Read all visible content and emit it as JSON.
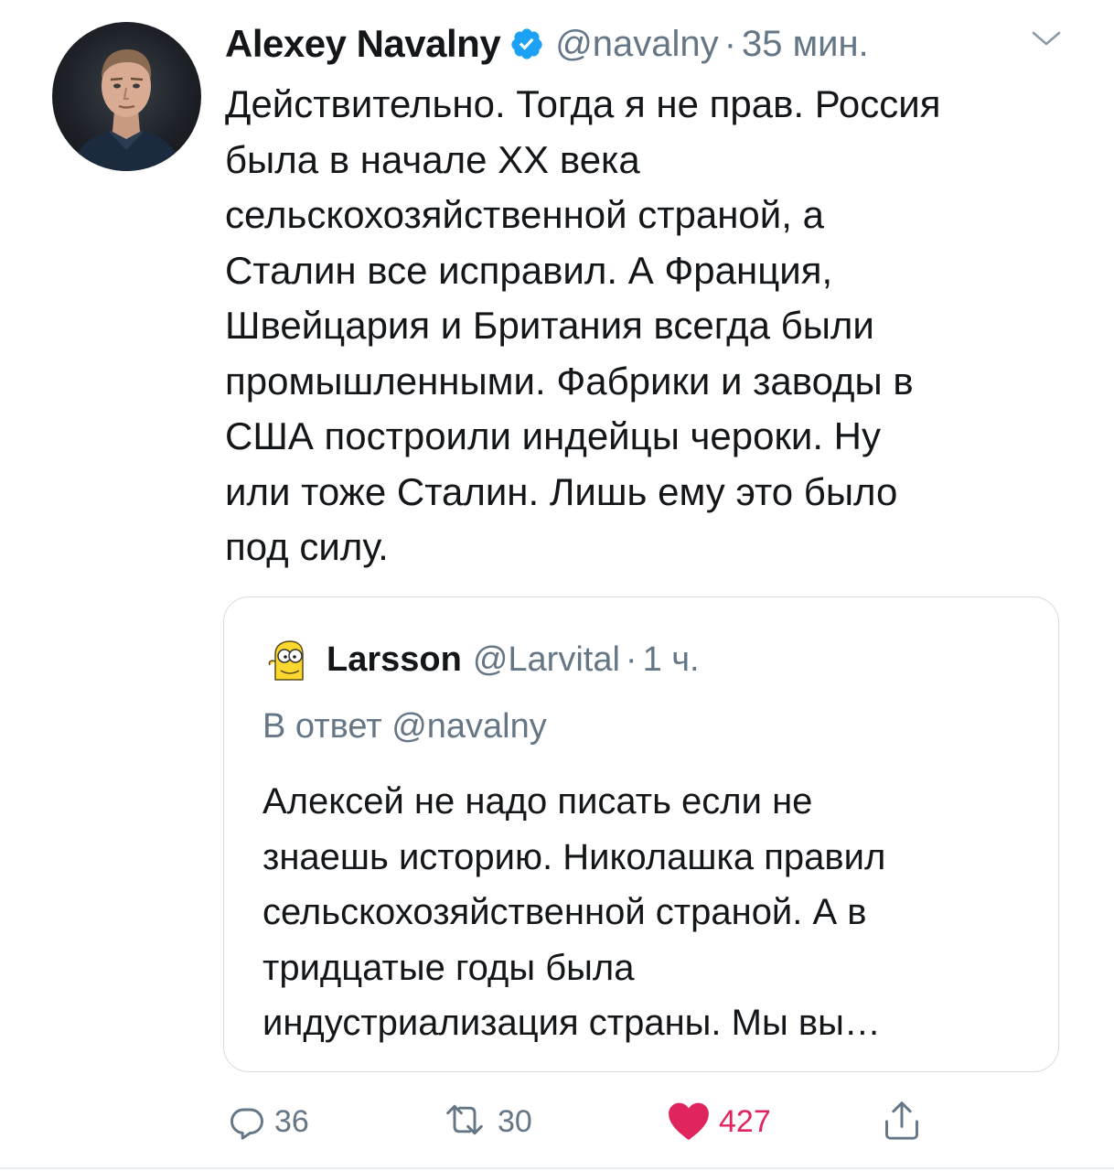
{
  "tweet": {
    "author_name": "Alexey Navalny",
    "handle": "@navalny",
    "separator": "·",
    "time": "35 мин.",
    "text_lines": [
      "Действительно. Тогда я не прав. Россия",
      "была в начале XX века",
      "сельскохозяйственной страной, а",
      "Сталин все исправил. А Франция,",
      "Швейцария и Британия всегда были",
      "промышленными. Фабрики и заводы в",
      "США построили индейцы чероки. Ну",
      "или тоже Сталин. Лишь ему это было",
      "под силу."
    ],
    "icons": {
      "verified": "verified-badge-icon",
      "menu": "chevron-down-icon"
    }
  },
  "quoted_tweet": {
    "author_name": "Larsson",
    "handle": "@Larvital",
    "separator": "·",
    "time": "1 ч.",
    "reply_to": "В ответ @navalny",
    "text_lines": [
      "Алексей не надо писать если не",
      "знаешь историю. Николашка правил",
      "сельскохозяйственной страной. А в",
      "тридцатые годы была",
      "индустриализация страны. Мы вы…"
    ]
  },
  "actions": {
    "reply_count": "36",
    "retweet_count": "30",
    "like_count": "427"
  },
  "colors": {
    "text": "#14171a",
    "secondary": "#657786",
    "verified_blue": "#1da1f2",
    "like_red": "#e0245e",
    "border": "#d5dce2"
  }
}
